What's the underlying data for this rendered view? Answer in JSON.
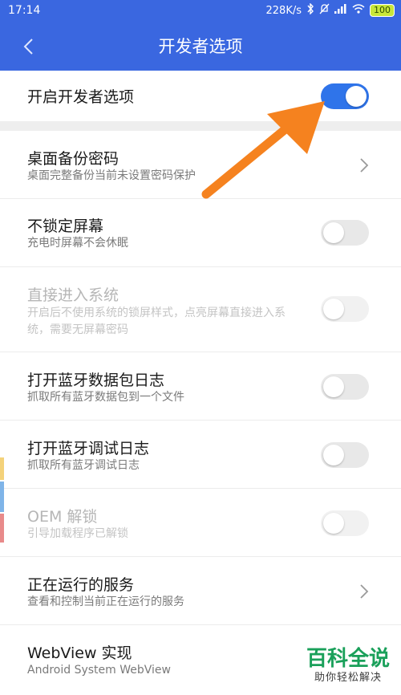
{
  "status_bar": {
    "time": "17:14",
    "network_speed": "228K/s",
    "battery_level": "100",
    "icons": [
      "bluetooth-icon",
      "alarm-off-icon",
      "signal-icon",
      "wifi-icon",
      "battery-icon"
    ]
  },
  "header": {
    "title": "开发者选项",
    "back_icon": "chevron-left-icon"
  },
  "master_toggle": {
    "label": "开启开发者选项",
    "on": true
  },
  "settings": [
    {
      "title": "桌面备份密码",
      "subtitle": "桌面完整备份当前未设置密码保护",
      "control": "chevron",
      "enabled": true
    },
    {
      "title": "不锁定屏幕",
      "subtitle": "充电时屏幕不会休眠",
      "control": "toggle",
      "on": false,
      "enabled": true
    },
    {
      "title": "直接进入系统",
      "subtitle": "开启后不使用系统的锁屏样式，点亮屏幕直接进入系统，需要无屏幕密码",
      "control": "toggle",
      "on": false,
      "enabled": false
    },
    {
      "title": "打开蓝牙数据包日志",
      "subtitle": "抓取所有蓝牙数据包到一个文件",
      "control": "toggle",
      "on": false,
      "enabled": true
    },
    {
      "title": "打开蓝牙调试日志",
      "subtitle": "抓取所有蓝牙调试日志",
      "control": "toggle",
      "on": false,
      "enabled": true
    },
    {
      "title": "OEM 解锁",
      "subtitle": "引导加载程序已解锁",
      "control": "toggle",
      "on": false,
      "enabled": false
    },
    {
      "title": "正在运行的服务",
      "subtitle": "查看和控制当前正在运行的服务",
      "control": "chevron",
      "enabled": true
    },
    {
      "title": "WebView 实现",
      "subtitle": "Android System WebView",
      "control": "none",
      "enabled": true
    }
  ],
  "watermark": {
    "logo": "百科全说",
    "tagline": "助你轻松解决"
  },
  "colors": {
    "header_bg": "#3a67e0",
    "toggle_on": "#2f74ea",
    "annotation_arrow": "#f5821f",
    "watermark_green": "#1aa05a"
  }
}
